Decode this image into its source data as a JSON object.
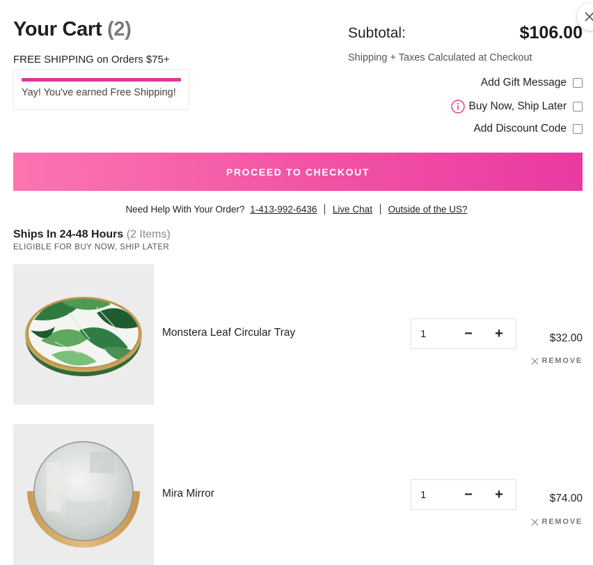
{
  "header": {
    "title": "Your Cart",
    "count": "(2)",
    "free_shipping_text": "FREE SHIPPING on Orders $75+",
    "free_shipping_message": "Yay! You've earned Free Shipping!",
    "free_shipping_progress": 1.0,
    "subtotal_label": "Subtotal:",
    "subtotal_value": "$106.00",
    "shipping_note": "Shipping + Taxes Calculated at Checkout"
  },
  "options": {
    "gift_message": "Add Gift Message",
    "buy_now_ship_later": "Buy Now, Ship Later",
    "discount_code": "Add Discount Code"
  },
  "checkout_label": "PROCEED TO CHECKOUT",
  "help": {
    "prefix": "Need Help With Your Order?",
    "phone": "1-413-992-6436",
    "live_chat": "Live Chat",
    "outside_us": "Outside of the US?"
  },
  "section": {
    "title": "Ships In 24-48 Hours",
    "items_count": "(2 Items)",
    "subtitle": "ELIGIBLE FOR BUY NOW, SHIP LATER"
  },
  "items": [
    {
      "name": "Monstera Leaf Circular Tray",
      "qty": "1",
      "price": "$32.00",
      "remove_label": "REMOVE"
    },
    {
      "name": "Mira Mirror",
      "qty": "1",
      "price": "$74.00",
      "remove_label": "REMOVE"
    }
  ],
  "qty_minus": "−",
  "qty_plus": "+",
  "colors": {
    "accent": "#e0369a",
    "checkout_gradient_start": "#fb75b0",
    "checkout_gradient_end": "#e93aa3"
  },
  "icons": {
    "close": "close-icon",
    "info": "info-icon",
    "remove": "x-icon"
  }
}
